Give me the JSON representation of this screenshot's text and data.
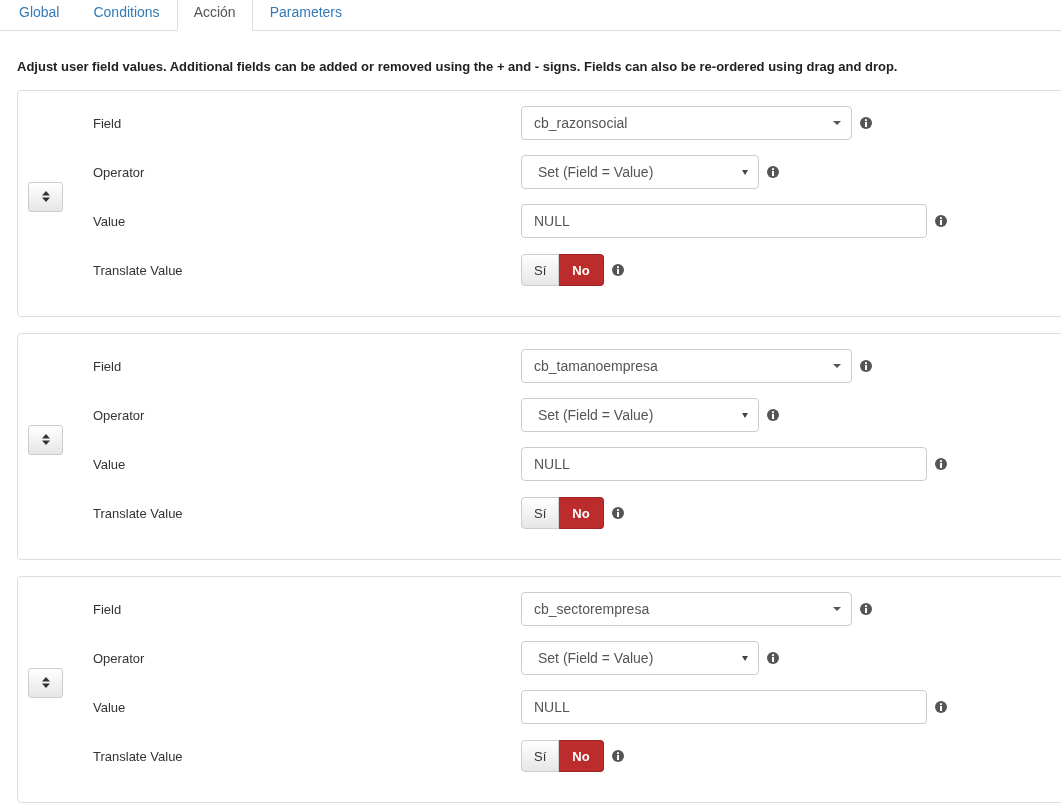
{
  "tabs": [
    {
      "label": "Global",
      "selected": false
    },
    {
      "label": "Conditions",
      "selected": false
    },
    {
      "label": "Acción",
      "selected": true
    },
    {
      "label": "Parameters",
      "selected": false
    }
  ],
  "intro": "Adjust user field values. Additional fields can be added or removed using the + and - signs. Fields can also be re-ordered using drag and drop.",
  "rules": [
    {
      "rows": [
        {
          "kind": "field",
          "label": "Field",
          "value": "cb_razonsocial"
        },
        {
          "kind": "operator",
          "label": "Operator",
          "value": "Set (Field = Value)"
        },
        {
          "kind": "text",
          "label": "Value",
          "value": "NULL"
        },
        {
          "kind": "toggle",
          "label": "Translate Value",
          "options": [
            {
              "label": "Sí",
              "selected": false
            },
            {
              "label": "No",
              "selected": true
            }
          ]
        }
      ]
    },
    {
      "rows": [
        {
          "kind": "field",
          "label": "Field",
          "value": "cb_tamanoempresa"
        },
        {
          "kind": "operator",
          "label": "Operator",
          "value": "Set (Field = Value)"
        },
        {
          "kind": "text",
          "label": "Value",
          "value": "NULL"
        },
        {
          "kind": "toggle",
          "label": "Translate Value",
          "options": [
            {
              "label": "Sí",
              "selected": false
            },
            {
              "label": "No",
              "selected": true
            }
          ]
        }
      ]
    },
    {
      "rows": [
        {
          "kind": "field",
          "label": "Field",
          "value": "cb_sectorempresa"
        },
        {
          "kind": "operator",
          "label": "Operator",
          "value": "Set (Field = Value)"
        },
        {
          "kind": "text",
          "label": "Value",
          "value": "NULL"
        },
        {
          "kind": "toggle",
          "label": "Translate Value",
          "options": [
            {
              "label": "Sí",
              "selected": false
            },
            {
              "label": "No",
              "selected": true
            }
          ]
        }
      ]
    }
  ]
}
